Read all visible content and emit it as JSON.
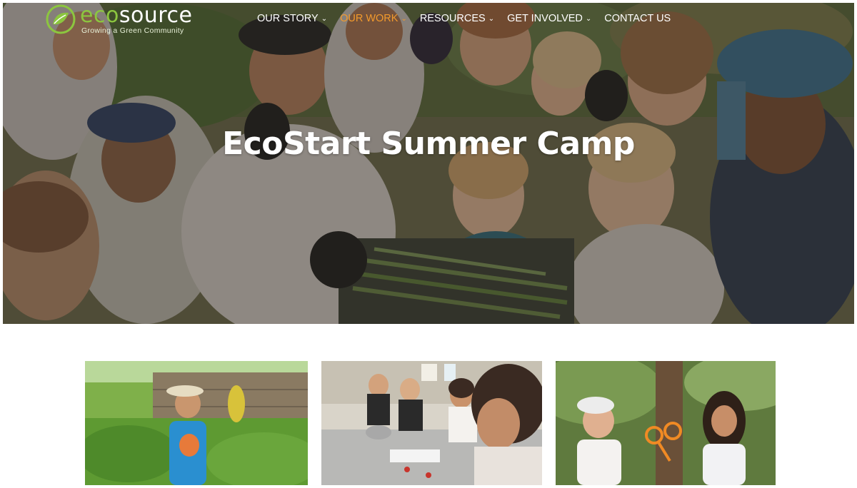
{
  "site": {
    "logo_word_eco": "eco",
    "logo_word_rest": "source",
    "logo_tagline": "Growing a Green Community",
    "brand_green": "#8cc63f",
    "accent_orange": "#f39a2c"
  },
  "nav": {
    "items": [
      {
        "label": "OUR STORY",
        "has_dropdown": true,
        "active": false
      },
      {
        "label": "OUR WORK",
        "has_dropdown": true,
        "active": true
      },
      {
        "label": "RESOURCES",
        "has_dropdown": true,
        "active": false
      },
      {
        "label": "GET INVOLVED",
        "has_dropdown": true,
        "active": false
      },
      {
        "label": "CONTACT US",
        "has_dropdown": false,
        "active": false
      }
    ],
    "dropdown_icon": "chevron-down-icon",
    "dropdown_glyph": "⌄"
  },
  "hero": {
    "title": "EcoStart Summer Camp"
  },
  "cards": [
    {
      "name": "garden-photo"
    },
    {
      "name": "cooking-photo"
    },
    {
      "name": "forest-photo"
    }
  ]
}
